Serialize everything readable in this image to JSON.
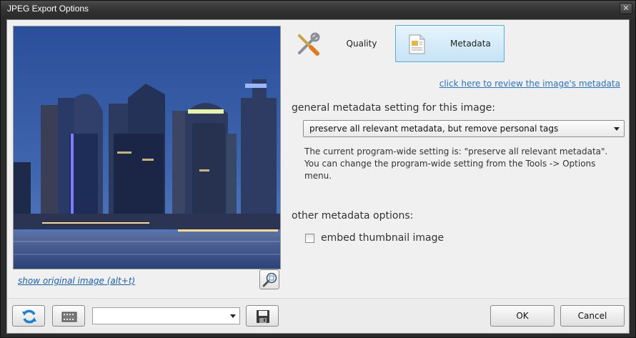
{
  "window": {
    "title": "JPEG Export Options",
    "close_glyph": "✕"
  },
  "preview": {
    "show_original_link": "show original image (alt+t)"
  },
  "tabs": [
    {
      "label": "Quality",
      "icon": "tools-icon",
      "selected": false
    },
    {
      "label": "Metadata",
      "icon": "document-icon",
      "selected": true
    }
  ],
  "metadata": {
    "review_link": "click here to review the image's metadata",
    "general_heading": "general metadata setting for this image:",
    "general_selected": "preserve all relevant metadata, but remove personal tags",
    "note": "The current program-wide setting is: \"preserve all relevant metadata\". You can change the program-wide setting from the Tools -> Options menu.",
    "other_heading": "other metadata options:",
    "embed_thumbnail_label": "embed thumbnail image",
    "embed_thumbnail_checked": false
  },
  "bottom": {
    "preset_value": "",
    "ok_label": "OK",
    "cancel_label": "Cancel"
  },
  "colors": {
    "link": "#2a73c9",
    "tab_selected_border": "#5aa9d6",
    "titlebar": "#333333"
  }
}
